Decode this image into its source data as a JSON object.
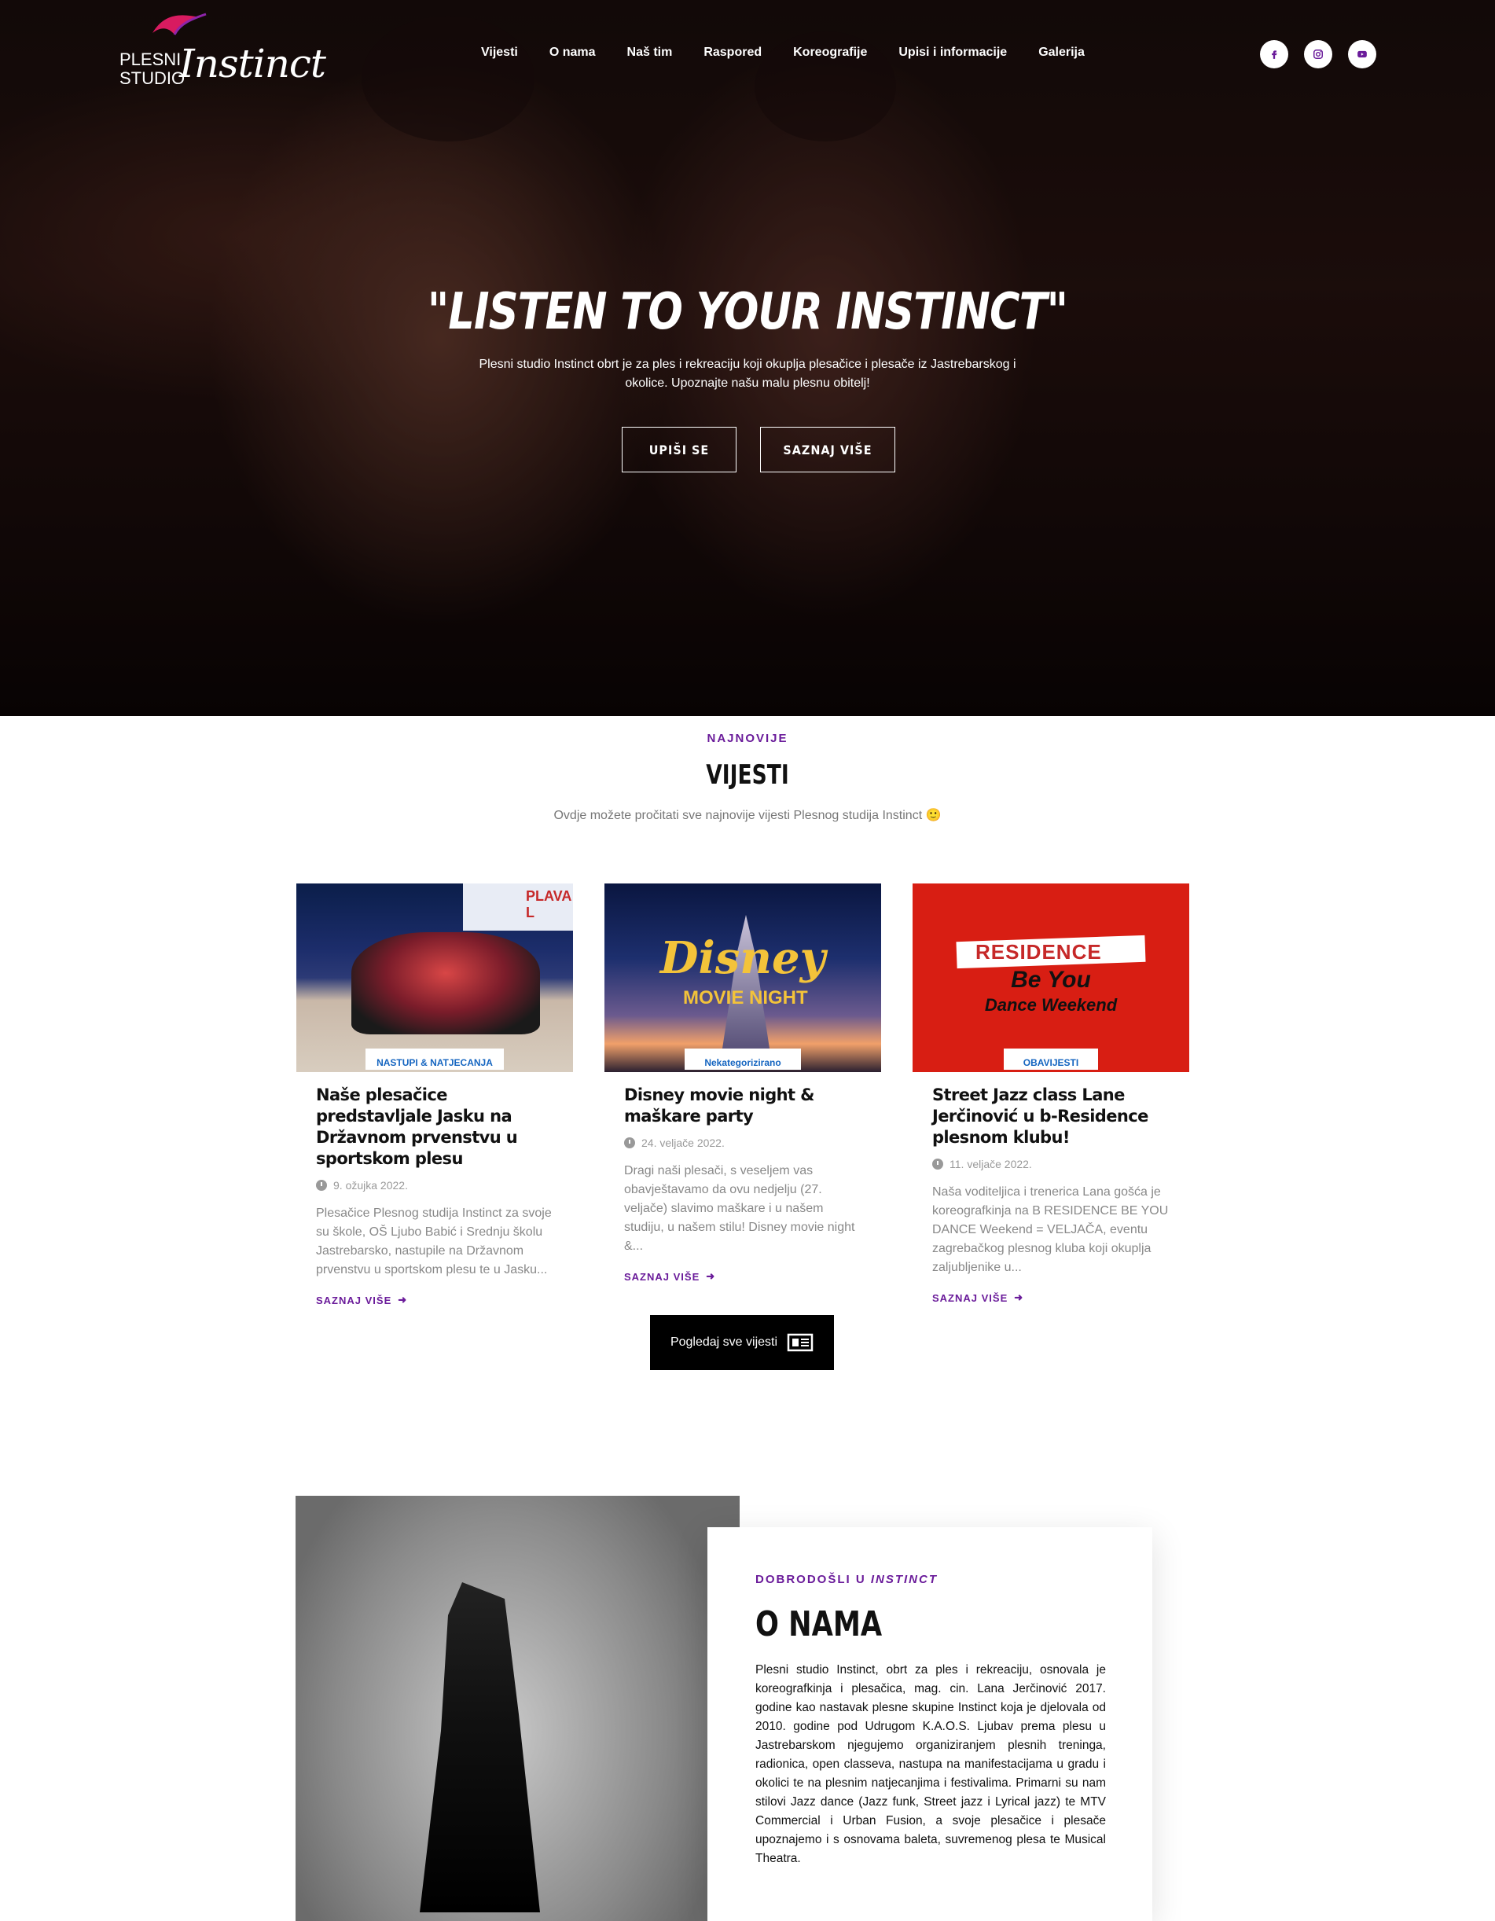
{
  "logo": {
    "line1": "PLESNI",
    "line2": "STUDIO",
    "wordmark": "Instinct"
  },
  "nav": {
    "items": [
      "Vijesti",
      "O nama",
      "Naš tim",
      "Raspored",
      "Koreografije",
      "Upisi i informacije",
      "Galerija"
    ]
  },
  "social": [
    {
      "icon": "facebook-icon"
    },
    {
      "icon": "instagram-icon"
    },
    {
      "icon": "youtube-icon"
    }
  ],
  "colors": {
    "accent": "#6a1b9a",
    "category": "#1565c0",
    "button_dark": "#000000"
  },
  "hero": {
    "title": "\"LISTEN TO YOUR INSTINCT\"",
    "subtitle": "Plesni studio Instinct obrt je za ples i rekreaciju koji okuplja plesačice i plesače iz Jastrebarskog i okolice. Upoznajte našu malu plesnu obitelj!",
    "btn_primary": "UPIŠI SE",
    "btn_secondary": "SAZNAJ VIŠE"
  },
  "news": {
    "eyebrow": "NAJNOVIJE",
    "title": "VIJESTI",
    "subtitle": "Ovdje možete pročitati sve najnovije vijesti Plesnog studija Instinct 🙂",
    "cards": [
      {
        "category": "NASTUPI & NATJECANJA",
        "title": "Naše plesačice predstavljale Jasku na Državnom prvenstvu u sportskom plesu",
        "date": "9. ožujka 2022.",
        "excerpt": "Plesačice Plesnog studija Instinct za svoje su škole, OŠ Ljubo Babić i Srednju školu Jastrebarsko, nastupile na Državnom prvenstvu u sportskom plesu te u Jasku...",
        "more": "SAZNAJ VIŠE",
        "image_text": "PLAVA L"
      },
      {
        "category": "Nekategorizirano",
        "title": "Disney movie night & maškare party",
        "date": "24. veljače 2022.",
        "excerpt": "Dragi naši plesači, s veseljem vas obavještavamo da ovu nedjelju (27. veljače) slavimo maškare i u našem studiju, u našem stilu! Disney movie night &...",
        "more": "SAZNAJ VIŠE",
        "image_text": "Disney",
        "image_text2": "MOVIE NIGHT"
      },
      {
        "category": "OBAVIJESTI",
        "title": "Street Jazz class Lane Jerčinović u b-Residence plesnom klubu!",
        "date": "11. veljače 2022.",
        "excerpt": "Naša voditeljica i trenerica Lana gošća je koreografkinja na B RESIDENCE BE YOU DANCE Weekend = VELJAČA, eventu zagrebačkog plesnog kluba koji okuplja zaljubljenike u...",
        "more": "SAZNAJ VIŠE",
        "image_text": "RESIDENCE",
        "image_text2": "Be You",
        "image_text3": "Dance Weekend"
      }
    ],
    "all_button": "Pogledaj sve vijesti"
  },
  "about": {
    "eyebrow_prefix": "DOBRODOŠLI U",
    "eyebrow_em": "INSTINCT",
    "title": "O NAMA",
    "text": "Plesni studio Instinct, obrt za ples i rekreaciju, osnovala je koreografkinja i plesačica, mag. cin. Lana Jerčinović 2017. godine kao nastavak plesne skupine Instinct koja je djelovala od 2010. godine pod Udrugom K.A.O.S. Ljubav prema plesu u Jastrebarskom njegujemo organiziranjem plesnih treninga, radionica, open classeva, nastupa na manifestacijama u gradu i okolici te na plesnim natjecanjima i festivalima. Primarni su nam stilovi Jazz dance (Jazz funk, Street jazz i Lyrical jazz) te MTV Commercial i Urban Fusion, a svoje plesačice i plesače upoznajemo i s osnovama baleta, suvremenog plesa te Musical Theatra."
  }
}
